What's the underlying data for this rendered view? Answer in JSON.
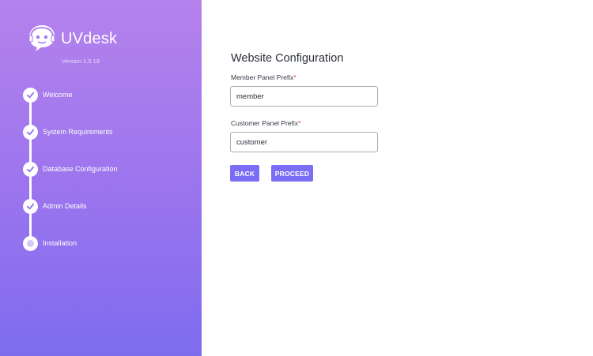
{
  "app": {
    "brand": "UVdesk",
    "version": "Version 1.0.18"
  },
  "steps": [
    {
      "label": "Welcome",
      "status": "done"
    },
    {
      "label": "System Requirements",
      "status": "done"
    },
    {
      "label": "Database Configuration",
      "status": "done"
    },
    {
      "label": "Admin Details",
      "status": "done"
    },
    {
      "label": "Installation",
      "status": "current"
    }
  ],
  "form": {
    "title": "Website Configuration",
    "member_prefix": {
      "label": "Member Panel Prefix",
      "required_mark": "*",
      "value": "member"
    },
    "customer_prefix": {
      "label": "Customer Panel Prefix",
      "required_mark": "*",
      "value": "customer"
    }
  },
  "buttons": {
    "back": "BACK",
    "proceed": "PROCEED"
  },
  "icons": {
    "logo": "headset-chat-logo-icon",
    "step_done": "check-icon",
    "step_current": "dot-icon"
  },
  "colors": {
    "sidebar_gradient_top": "#b582ec",
    "sidebar_gradient_bottom": "#7e6cef",
    "button": "#7a6ef5",
    "required": "#e0354e"
  }
}
